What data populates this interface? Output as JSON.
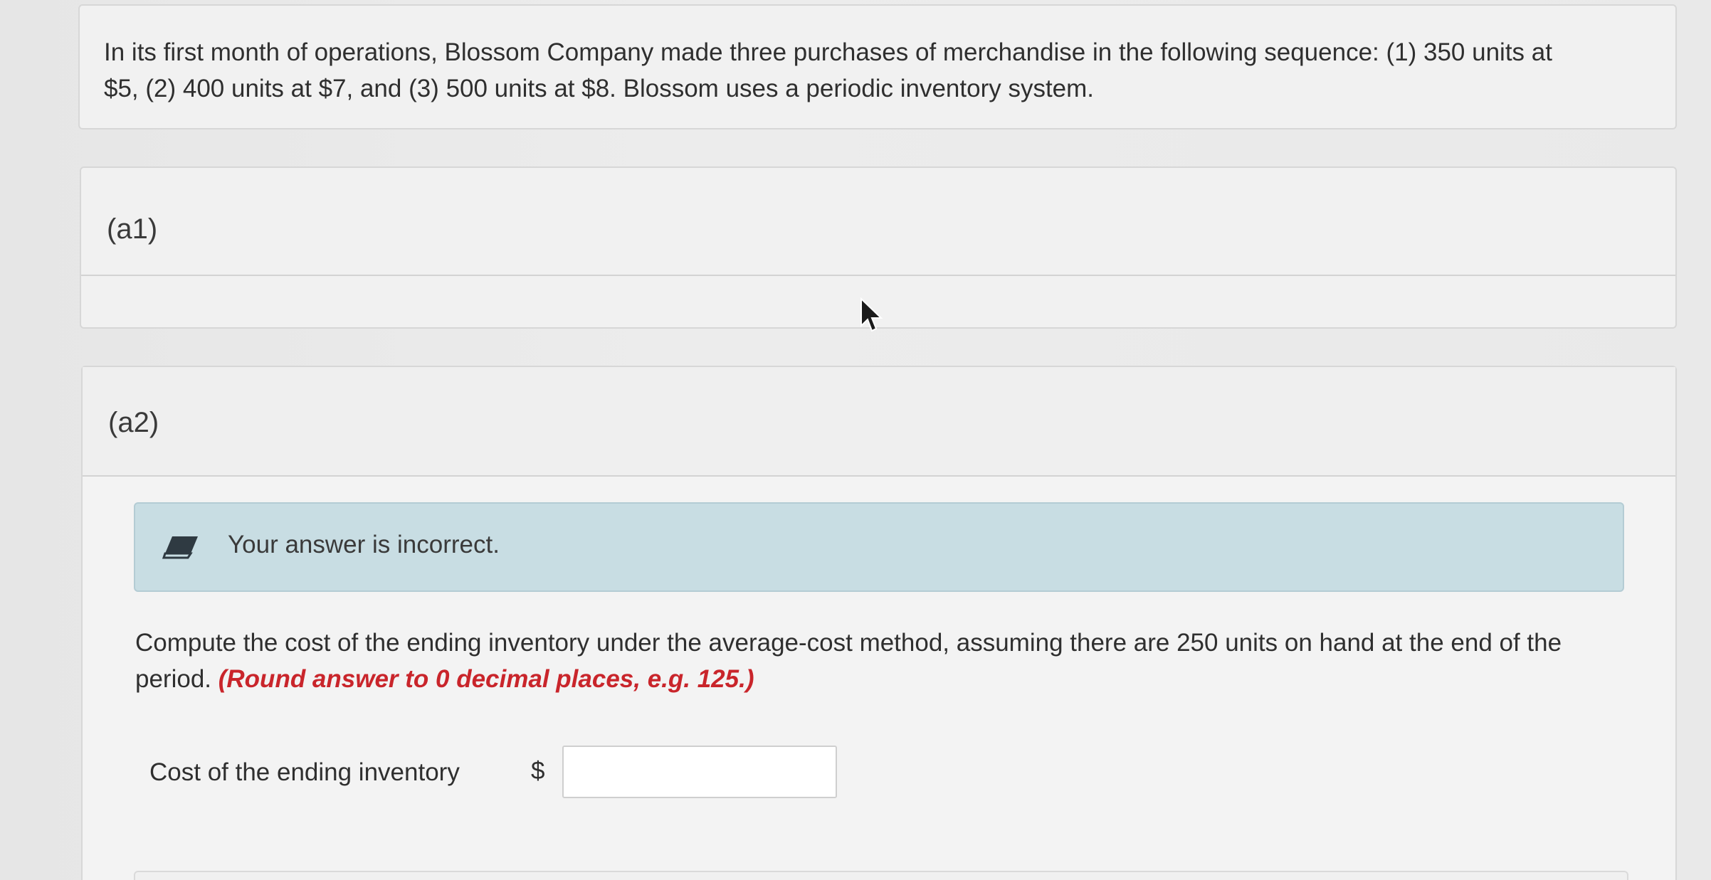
{
  "problem": {
    "line1": "In its first month of operations, Blossom Company made three purchases of merchandise in the following sequence: (1) 350 units at",
    "line2": "$5, (2) 400 units at $7, and (3) 500 units at $8. Blossom uses a periodic inventory system."
  },
  "parts": {
    "a1": {
      "label": "(a1)"
    },
    "a2": {
      "label": "(a2)",
      "feedback": {
        "icon": "pencil-eraser-icon",
        "text": "Your answer is incorrect."
      },
      "question": {
        "line1": "Compute the cost of the ending inventory under the average-cost method, assuming there are 250 units on hand at the end of the",
        "line2_prefix": "period. ",
        "hint": "(Round answer to 0 decimal places, e.g. 125.)"
      },
      "answer": {
        "label": "Cost of the ending inventory",
        "currency": "$",
        "value": ""
      }
    }
  },
  "colors": {
    "feedback_bg": "#c8dde3",
    "hint_red": "#c9252b"
  }
}
